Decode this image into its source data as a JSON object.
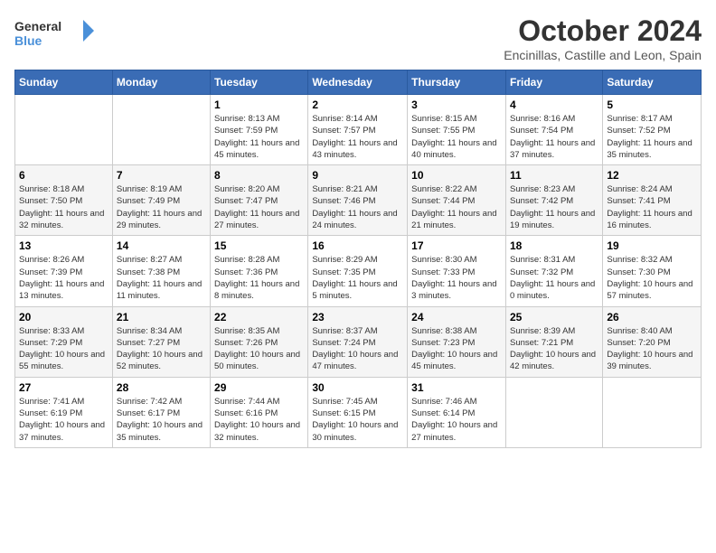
{
  "header": {
    "logo_line1": "General",
    "logo_line2": "Blue",
    "title": "October 2024",
    "subtitle": "Encinillas, Castille and Leon, Spain"
  },
  "calendar": {
    "days_of_week": [
      "Sunday",
      "Monday",
      "Tuesday",
      "Wednesday",
      "Thursday",
      "Friday",
      "Saturday"
    ],
    "weeks": [
      [
        {
          "day": "",
          "info": ""
        },
        {
          "day": "",
          "info": ""
        },
        {
          "day": "1",
          "sunrise": "8:13 AM",
          "sunset": "7:59 PM",
          "daylight": "11 hours and 45 minutes."
        },
        {
          "day": "2",
          "sunrise": "8:14 AM",
          "sunset": "7:57 PM",
          "daylight": "11 hours and 43 minutes."
        },
        {
          "day": "3",
          "sunrise": "8:15 AM",
          "sunset": "7:55 PM",
          "daylight": "11 hours and 40 minutes."
        },
        {
          "day": "4",
          "sunrise": "8:16 AM",
          "sunset": "7:54 PM",
          "daylight": "11 hours and 37 minutes."
        },
        {
          "day": "5",
          "sunrise": "8:17 AM",
          "sunset": "7:52 PM",
          "daylight": "11 hours and 35 minutes."
        }
      ],
      [
        {
          "day": "6",
          "sunrise": "8:18 AM",
          "sunset": "7:50 PM",
          "daylight": "11 hours and 32 minutes."
        },
        {
          "day": "7",
          "sunrise": "8:19 AM",
          "sunset": "7:49 PM",
          "daylight": "11 hours and 29 minutes."
        },
        {
          "day": "8",
          "sunrise": "8:20 AM",
          "sunset": "7:47 PM",
          "daylight": "11 hours and 27 minutes."
        },
        {
          "day": "9",
          "sunrise": "8:21 AM",
          "sunset": "7:46 PM",
          "daylight": "11 hours and 24 minutes."
        },
        {
          "day": "10",
          "sunrise": "8:22 AM",
          "sunset": "7:44 PM",
          "daylight": "11 hours and 21 minutes."
        },
        {
          "day": "11",
          "sunrise": "8:23 AM",
          "sunset": "7:42 PM",
          "daylight": "11 hours and 19 minutes."
        },
        {
          "day": "12",
          "sunrise": "8:24 AM",
          "sunset": "7:41 PM",
          "daylight": "11 hours and 16 minutes."
        }
      ],
      [
        {
          "day": "13",
          "sunrise": "8:26 AM",
          "sunset": "7:39 PM",
          "daylight": "11 hours and 13 minutes."
        },
        {
          "day": "14",
          "sunrise": "8:27 AM",
          "sunset": "7:38 PM",
          "daylight": "11 hours and 11 minutes."
        },
        {
          "day": "15",
          "sunrise": "8:28 AM",
          "sunset": "7:36 PM",
          "daylight": "11 hours and 8 minutes."
        },
        {
          "day": "16",
          "sunrise": "8:29 AM",
          "sunset": "7:35 PM",
          "daylight": "11 hours and 5 minutes."
        },
        {
          "day": "17",
          "sunrise": "8:30 AM",
          "sunset": "7:33 PM",
          "daylight": "11 hours and 3 minutes."
        },
        {
          "day": "18",
          "sunrise": "8:31 AM",
          "sunset": "7:32 PM",
          "daylight": "11 hours and 0 minutes."
        },
        {
          "day": "19",
          "sunrise": "8:32 AM",
          "sunset": "7:30 PM",
          "daylight": "10 hours and 57 minutes."
        }
      ],
      [
        {
          "day": "20",
          "sunrise": "8:33 AM",
          "sunset": "7:29 PM",
          "daylight": "10 hours and 55 minutes."
        },
        {
          "day": "21",
          "sunrise": "8:34 AM",
          "sunset": "7:27 PM",
          "daylight": "10 hours and 52 minutes."
        },
        {
          "day": "22",
          "sunrise": "8:35 AM",
          "sunset": "7:26 PM",
          "daylight": "10 hours and 50 minutes."
        },
        {
          "day": "23",
          "sunrise": "8:37 AM",
          "sunset": "7:24 PM",
          "daylight": "10 hours and 47 minutes."
        },
        {
          "day": "24",
          "sunrise": "8:38 AM",
          "sunset": "7:23 PM",
          "daylight": "10 hours and 45 minutes."
        },
        {
          "day": "25",
          "sunrise": "8:39 AM",
          "sunset": "7:21 PM",
          "daylight": "10 hours and 42 minutes."
        },
        {
          "day": "26",
          "sunrise": "8:40 AM",
          "sunset": "7:20 PM",
          "daylight": "10 hours and 39 minutes."
        }
      ],
      [
        {
          "day": "27",
          "sunrise": "7:41 AM",
          "sunset": "6:19 PM",
          "daylight": "10 hours and 37 minutes."
        },
        {
          "day": "28",
          "sunrise": "7:42 AM",
          "sunset": "6:17 PM",
          "daylight": "10 hours and 35 minutes."
        },
        {
          "day": "29",
          "sunrise": "7:44 AM",
          "sunset": "6:16 PM",
          "daylight": "10 hours and 32 minutes."
        },
        {
          "day": "30",
          "sunrise": "7:45 AM",
          "sunset": "6:15 PM",
          "daylight": "10 hours and 30 minutes."
        },
        {
          "day": "31",
          "sunrise": "7:46 AM",
          "sunset": "6:14 PM",
          "daylight": "10 hours and 27 minutes."
        },
        {
          "day": "",
          "info": ""
        },
        {
          "day": "",
          "info": ""
        }
      ]
    ],
    "labels": {
      "sunrise": "Sunrise:",
      "sunset": "Sunset:",
      "daylight": "Daylight:"
    }
  }
}
